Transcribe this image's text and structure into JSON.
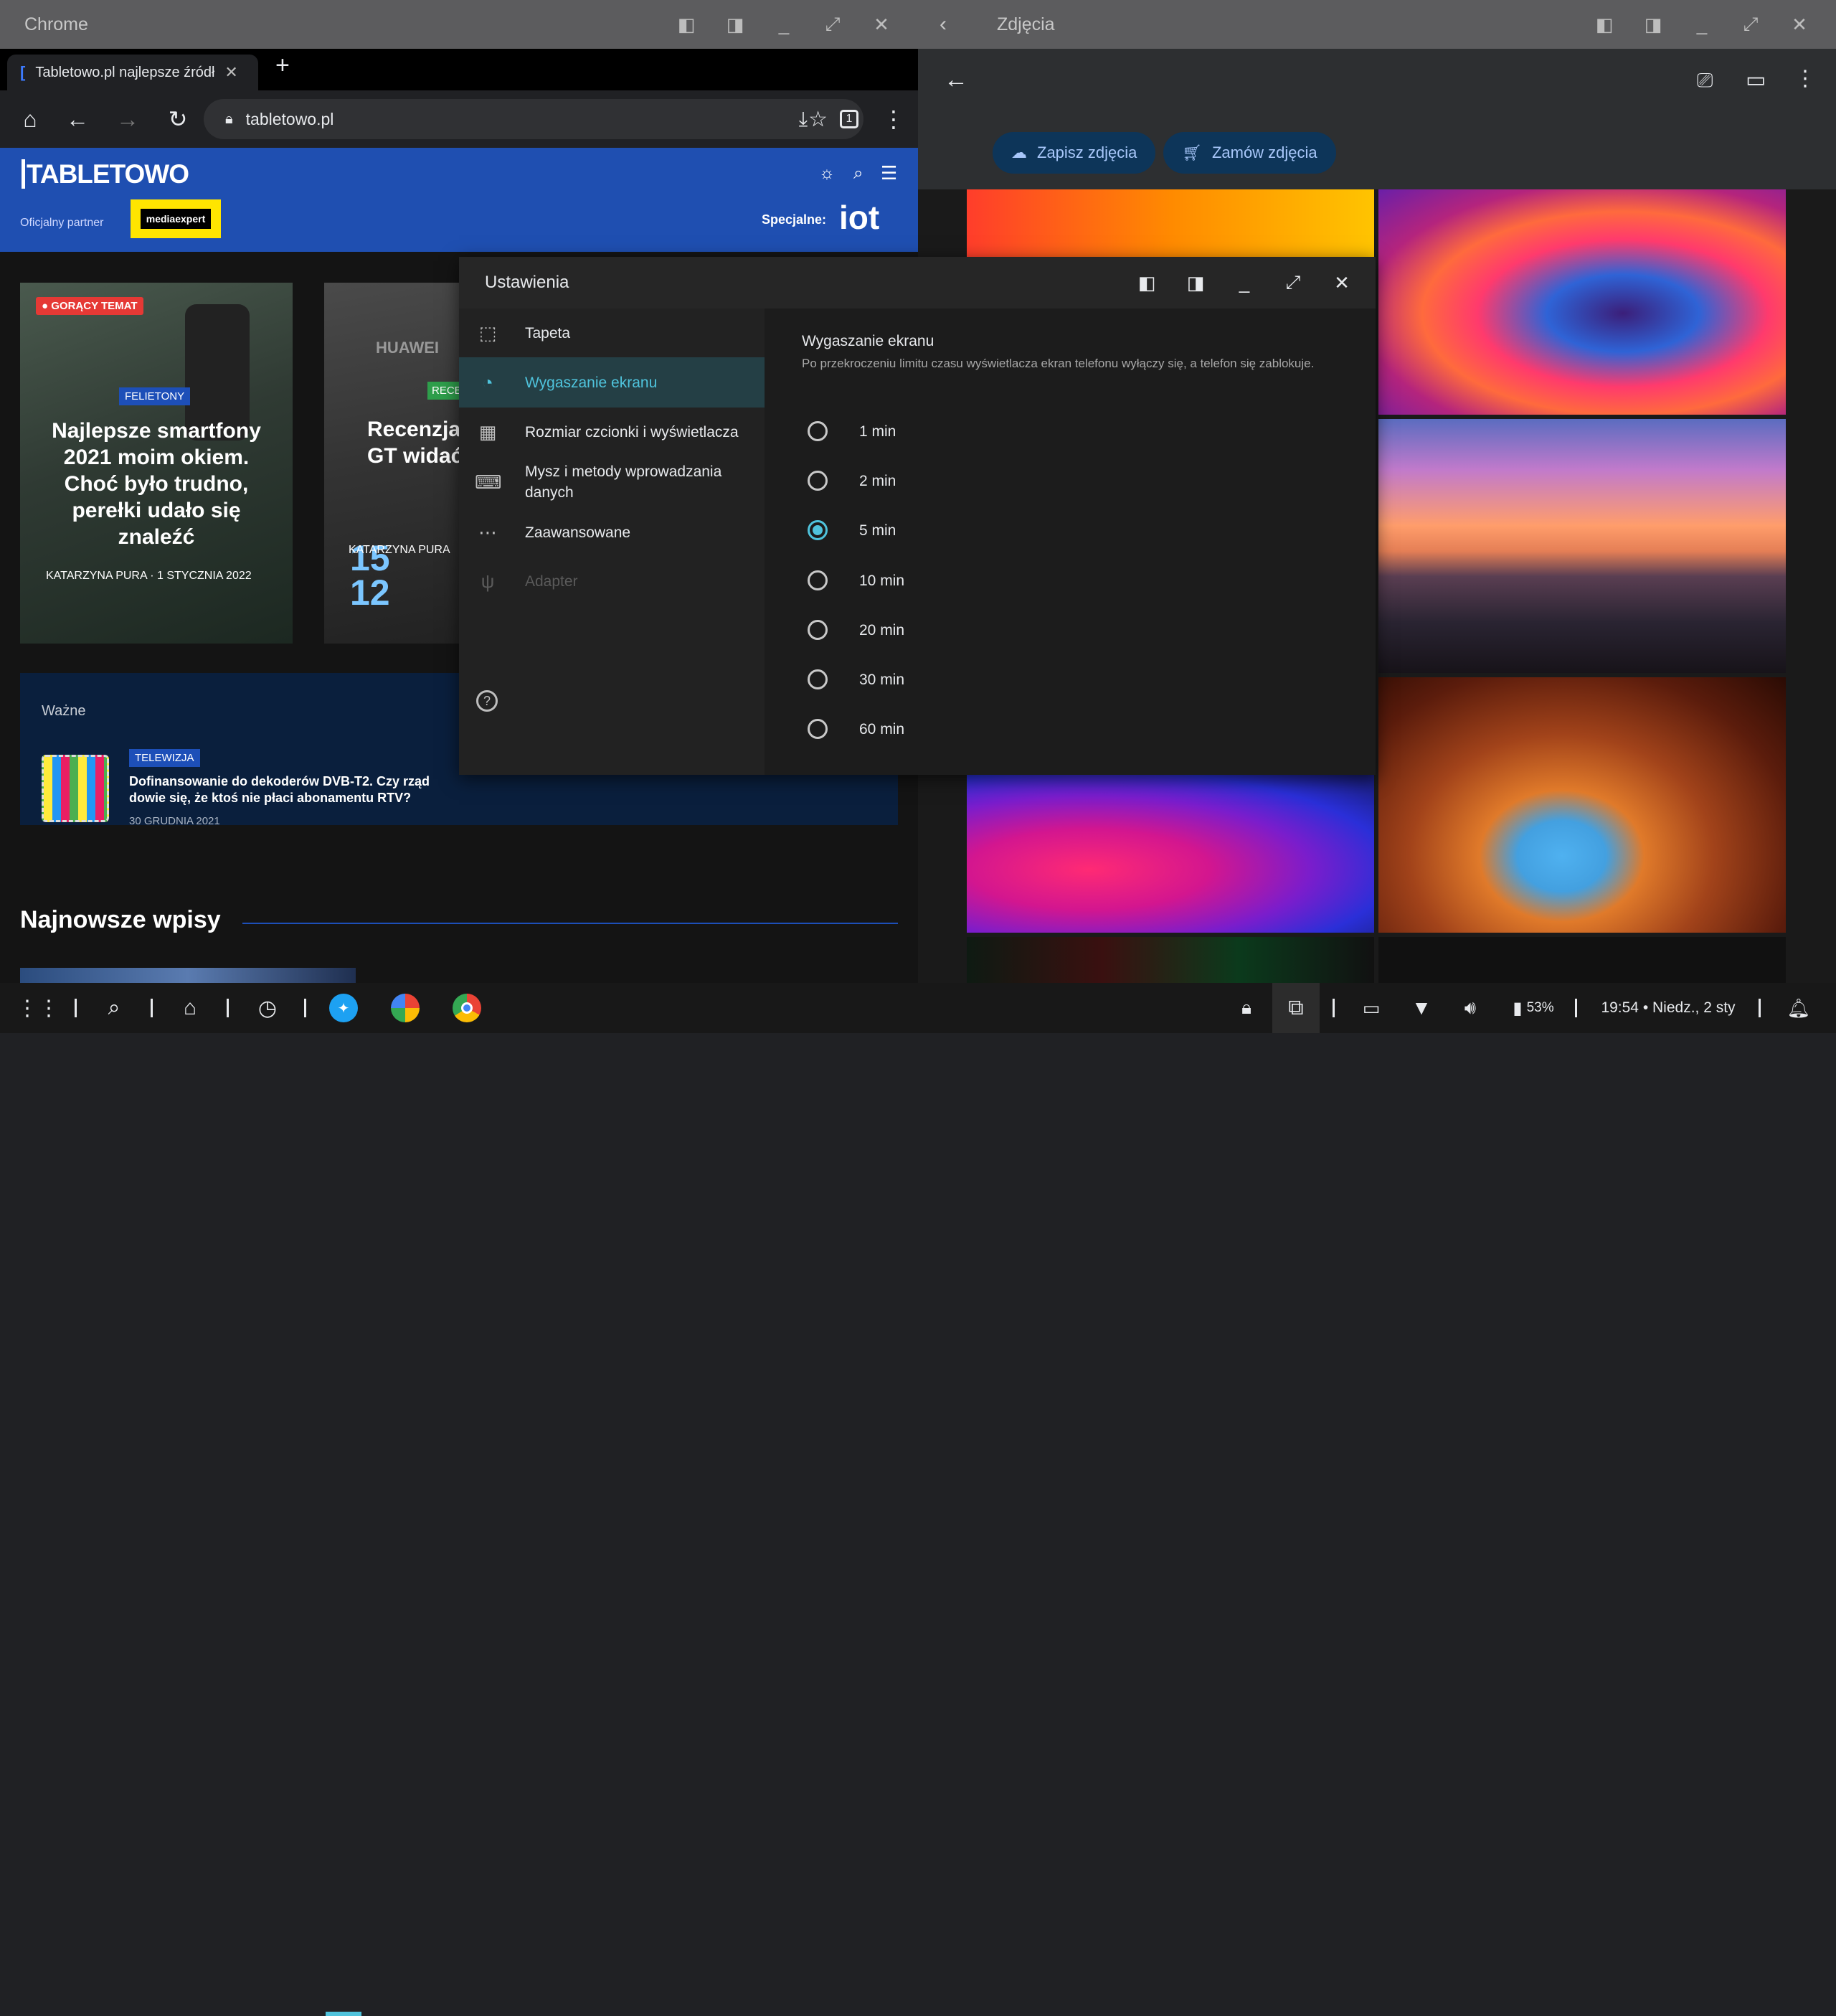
{
  "chrome": {
    "window_title": "Chrome",
    "tab_title": "Tabletowo.pl najlepsze źródło",
    "url": "tabletowo.pl",
    "tab_count": "1"
  },
  "site": {
    "logo": "TABLETOWO",
    "partner_label": "Oficjalny partner",
    "partner_name": "mediaexpert",
    "special_label": "Specjalne:",
    "special_name": "iot",
    "card1": {
      "hot_badge": "GORĄCY TEMAT",
      "category": "FELIETONY",
      "title": "Najlepsze smartfony 2021 moim okiem. Choć było trudno, perełki udało się znaleźć",
      "author": "KATARZYNA PURA",
      "date": "1 STYCZNIA 2022"
    },
    "card2": {
      "category": "RECE",
      "title": "Recenzja Watch GT widać",
      "author": "KATARZYNA PURA",
      "brand_text": "HUAWEI",
      "watch_digits_top": "15",
      "watch_digits_bottom": "12"
    },
    "important": {
      "label": "Ważne",
      "category": "TELEWIZJA",
      "title": "Dofinansowanie do dekoderów DVB-T2. Czy rząd dowie się, że ktoś nie płaci abonamentu RTV?",
      "date": "30 GRUDNIA 2021"
    },
    "latest_heading": "Najnowsze wpisy"
  },
  "photos": {
    "window_title": "Zdjęcia",
    "save_button": "Zapisz zdjęcia",
    "order_button": "Zamów zdjęcia"
  },
  "settings": {
    "title": "Ustawienia",
    "menu": [
      {
        "label": "Tapeta",
        "icon": "wallpaper-icon"
      },
      {
        "label": "Wygaszanie ekranu",
        "icon": "screen-timeout-icon"
      },
      {
        "label": "Rozmiar czcionki i wyświetlacza",
        "icon": "grid-icon"
      },
      {
        "label": "Mysz i metody wprowadzania danych",
        "icon": "keyboard-icon"
      },
      {
        "label": "Zaawansowane",
        "icon": "more-icon"
      },
      {
        "label": "Adapter",
        "icon": "usb-icon"
      }
    ],
    "section_title": "Wygaszanie ekranu",
    "section_description": "Po przekroczeniu limitu czasu wyświetlacza ekran telefonu wyłączy się, a telefon się zablokuje.",
    "options": [
      "1 min",
      "2 min",
      "5 min",
      "10 min",
      "20 min",
      "30 min",
      "60 min"
    ],
    "selected": "5 min"
  },
  "taskbar": {
    "battery": "53%",
    "clock": "19:54 • Niedz., 2 sty"
  },
  "colors": {
    "accent": "#4fc3dc",
    "site_blue": "#1f4fb1",
    "hot_red": "#e53935",
    "category_blue": "#1d4fb8"
  }
}
